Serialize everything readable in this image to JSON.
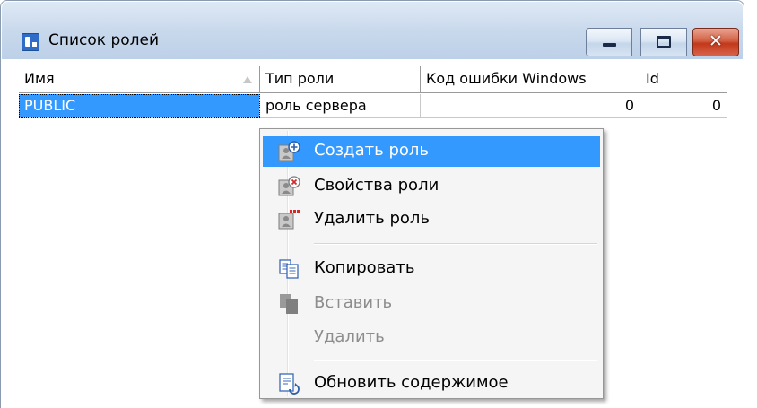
{
  "window": {
    "title": "Список ролей",
    "close_glyph": "✕"
  },
  "grid": {
    "columns": [
      "Имя",
      "Тип роли",
      "Код ошибки Windows",
      "Id"
    ],
    "rows": [
      {
        "name": "PUBLIC",
        "type": "роль сервера",
        "error_code": "0",
        "id": "0"
      }
    ]
  },
  "context_menu": {
    "items": [
      {
        "label": "Создать роль",
        "icon": "create-role-icon",
        "state": "highlighted"
      },
      {
        "label": "Свойства роли",
        "icon": "role-properties-icon",
        "state": "enabled"
      },
      {
        "label": "Удалить роль",
        "icon": "delete-role-icon",
        "state": "enabled"
      },
      {
        "label": "Копировать",
        "icon": "copy-icon",
        "state": "enabled"
      },
      {
        "label": "Вставить",
        "icon": "paste-icon",
        "state": "disabled"
      },
      {
        "label": "Удалить",
        "icon": "",
        "state": "disabled"
      },
      {
        "label": "Обновить содержимое",
        "icon": "refresh-icon",
        "state": "enabled"
      }
    ]
  },
  "colors": {
    "selection": "#3399ff",
    "titlebar": "#c9d9ec",
    "close_button": "#c2381a"
  }
}
